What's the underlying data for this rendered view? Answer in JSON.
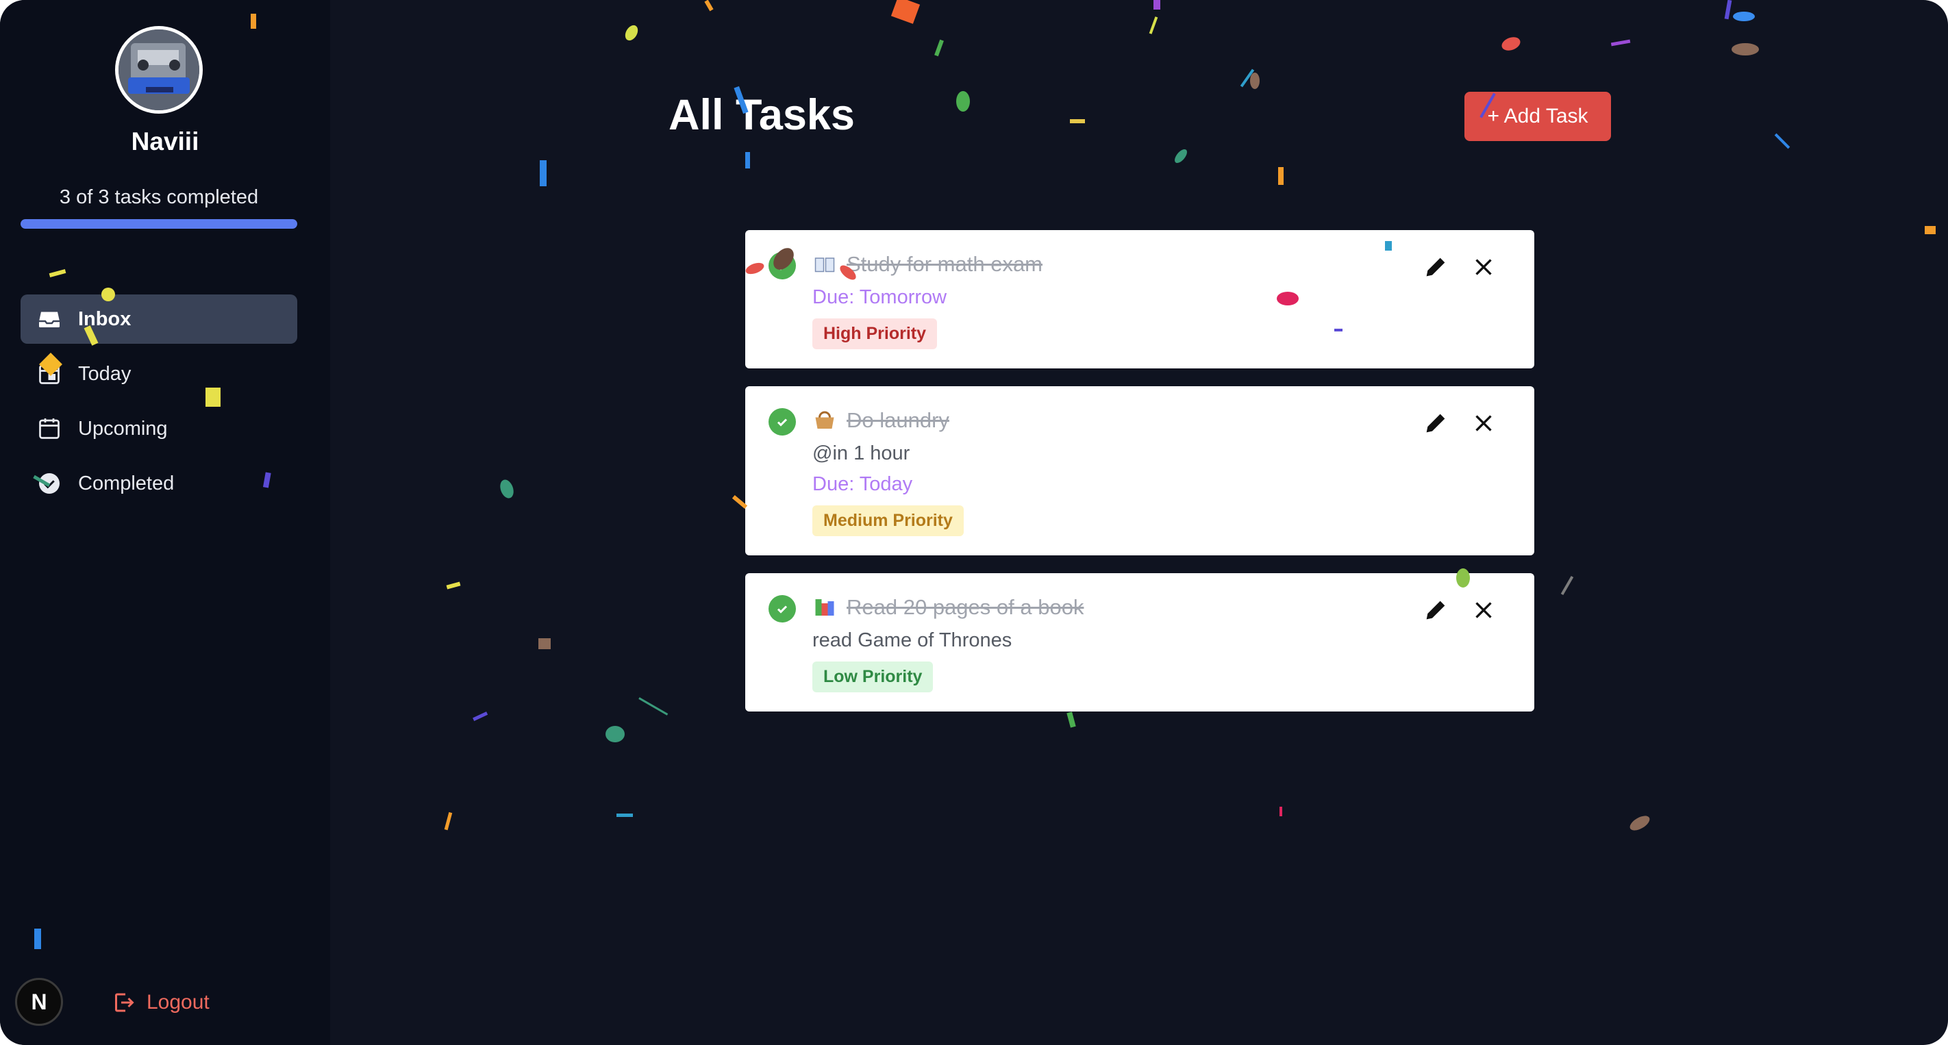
{
  "sidebar": {
    "username": "Naviii",
    "progress_text": "3 of 3 tasks completed",
    "progress_fraction": 1.0,
    "nav": [
      {
        "label": "Inbox",
        "icon": "inbox-icon",
        "active": true
      },
      {
        "label": "Today",
        "icon": "calendar-today-icon",
        "active": false
      },
      {
        "label": "Upcoming",
        "icon": "calendar-icon",
        "active": false
      },
      {
        "label": "Completed",
        "icon": "check-circle-icon",
        "active": false
      }
    ],
    "logout_label": "Logout",
    "corner_badge": "N"
  },
  "main": {
    "title": "All Tasks",
    "add_button": "+ Add Task"
  },
  "tasks": [
    {
      "title": "Study for math exam",
      "emoji": "book-icon",
      "description": "",
      "due": "Due: Tomorrow",
      "priority": "High Priority",
      "completed": true
    },
    {
      "title": "Do laundry",
      "emoji": "basket-icon",
      "description": "@in 1 hour",
      "due": "Due: Today",
      "priority": "Medium Priority",
      "completed": true
    },
    {
      "title": "Read 20 pages of a book",
      "emoji": "books-icon",
      "description": "read Game of Thrones",
      "due": "",
      "priority": "Low Priority",
      "completed": true
    }
  ],
  "colors": {
    "background": "#0f1320",
    "sidebar": "#0a0e1a",
    "accent": "#5b7cf0",
    "add_button": "#dc4b45",
    "due": "#b07af5",
    "check": "#4caf50"
  }
}
